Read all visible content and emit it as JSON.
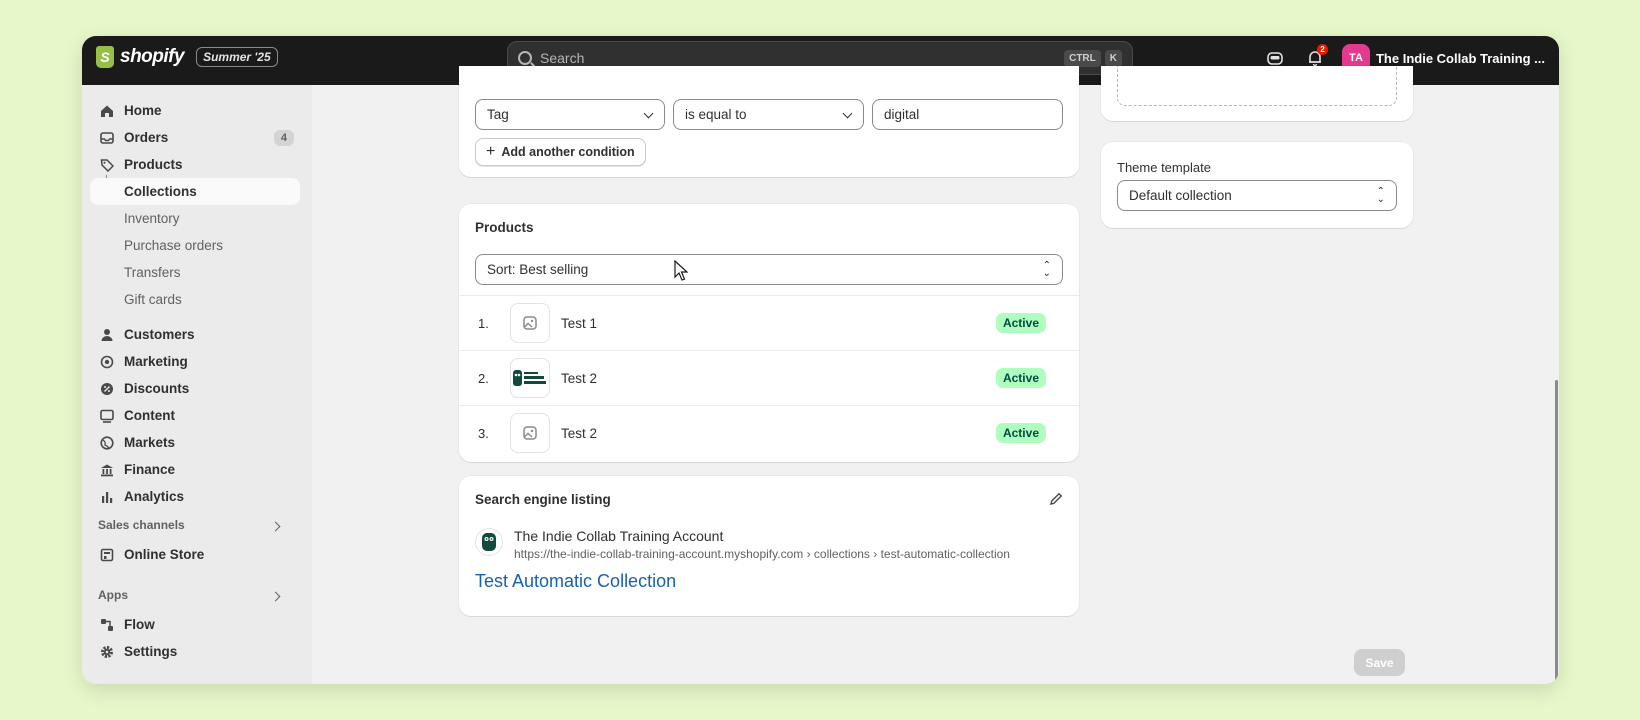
{
  "topbar": {
    "logo_text": "shopify",
    "edition": "Summer '25",
    "search_placeholder": "Search",
    "kbd_ctrl": "CTRL",
    "kbd_k": "K",
    "notification_count": "2",
    "avatar_initials": "TA",
    "store_name": "The Indie Collab Training ..."
  },
  "sidebar": {
    "home": "Home",
    "orders": "Orders",
    "orders_count": "4",
    "products": "Products",
    "collections": "Collections",
    "inventory": "Inventory",
    "purchase_orders": "Purchase orders",
    "transfers": "Transfers",
    "gift_cards": "Gift cards",
    "customers": "Customers",
    "marketing": "Marketing",
    "discounts": "Discounts",
    "content": "Content",
    "markets": "Markets",
    "finance": "Finance",
    "analytics": "Analytics",
    "sales_channels": "Sales channels",
    "online_store": "Online Store",
    "apps": "Apps",
    "flow": "Flow",
    "settings": "Settings"
  },
  "conditions": {
    "field": "Tag",
    "operator": "is equal to",
    "value": "digital",
    "add_condition": "Add another condition"
  },
  "products": {
    "title": "Products",
    "sort": "Sort: Best selling",
    "items": [
      {
        "num": "1.",
        "name": "Test 1",
        "status": "Active"
      },
      {
        "num": "2.",
        "name": "Test 2",
        "status": "Active"
      },
      {
        "num": "3.",
        "name": "Test 2",
        "status": "Active"
      }
    ]
  },
  "seo": {
    "title": "Search engine listing",
    "store": "The Indie Collab Training Account",
    "url": "https://the-indie-collab-training-account.myshopify.com › collections › test-automatic-collection",
    "page_title": "Test Automatic Collection"
  },
  "theme": {
    "label": "Theme template",
    "value": "Default collection"
  },
  "actions": {
    "save": "Save"
  },
  "colors": {
    "active_badge": "#affebf",
    "link": "#1a5fb4",
    "avatar": "#e33a8f",
    "background": "#e6f7c9"
  }
}
